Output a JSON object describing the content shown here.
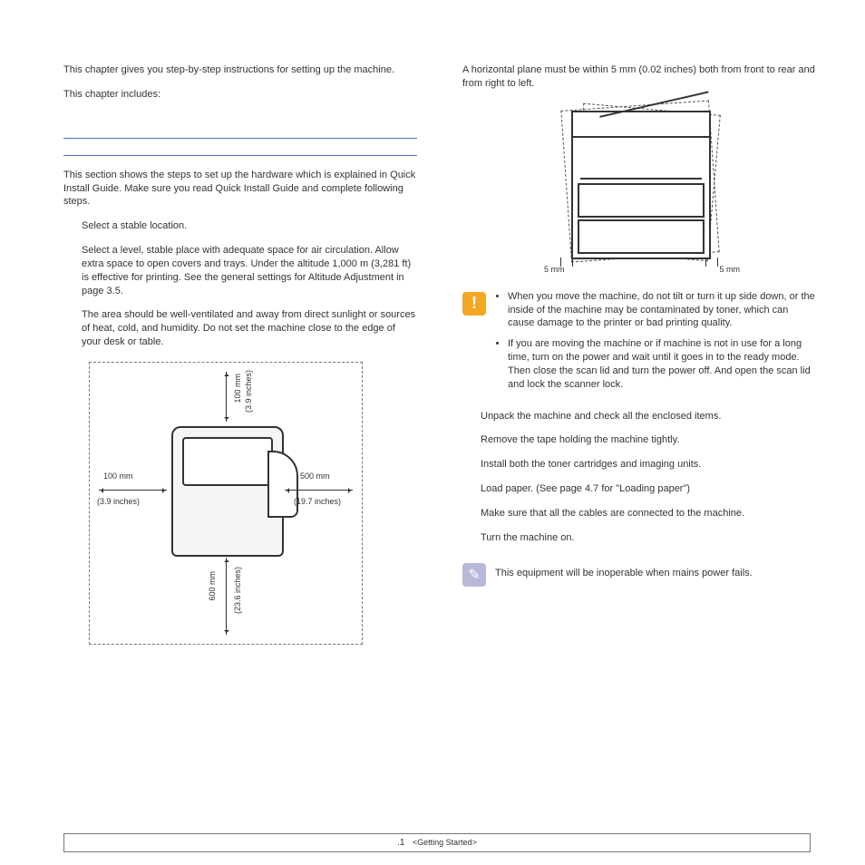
{
  "intro": {
    "p1": "This chapter gives you step-by-step instructions for setting up the machine.",
    "p2": "This chapter includes:"
  },
  "section1": {
    "lead": "This section shows the steps to set up the hardware which is explained in Quick Install Guide. Make sure you read Quick Install Guide and complete following steps.",
    "step_title": "Select a stable location.",
    "para1": "Select a level, stable place with adequate space for air circulation. Allow extra space to open covers and trays. Under the altitude 1,000 m (3,281 ft) is effective for printing. See the general settings for Altitude Adjustment in page 3.5.",
    "para2": "The area should be well-ventilated and away from direct sunlight or sources of heat, cold, and humidity. Do not set the machine close to the edge of your desk or table."
  },
  "clearance": {
    "top_mm": "100 mm",
    "top_in": "(3.9  inches)",
    "left_mm": "100 mm",
    "left_in": "(3.9  inches)",
    "right_mm": "500 mm",
    "right_in": "(19.7 inches)",
    "bottom_mm": "600 mm",
    "bottom_in": "(23.6  inches)"
  },
  "level": {
    "text": "A horizontal plane must be within 5 mm (0.02 inches) both from front to rear and from right to left.",
    "mm_left": "5 mm",
    "mm_right": "5 mm"
  },
  "caution": {
    "b1": "When you move the machine, do not tilt or turn it up side down, or the inside of the machine may be contaminated by toner, which can cause damage to the printer or bad printing quality.",
    "b2": "If you are moving the machine or if machine is not in use for a long time, turn on the power and wait until it goes in to the ready mode. Then close the scan lid and turn the power off. And open the scan lid and lock the scanner lock."
  },
  "steps": {
    "s1": "Unpack the machine and check all the enclosed items.",
    "s2": "Remove the tape holding the machine tightly.",
    "s3": "Install both the toner cartridges and imaging units.",
    "s4": "Load paper. (See  page 4.7 for \"Loading paper\")",
    "s5": "Make sure that all the cables are connected to the machine.",
    "s6": "Turn the machine on."
  },
  "note": "This equipment will be inoperable when mains power fails.",
  "footer": {
    "page": ".1",
    "chapter": "<Getting Started>"
  }
}
